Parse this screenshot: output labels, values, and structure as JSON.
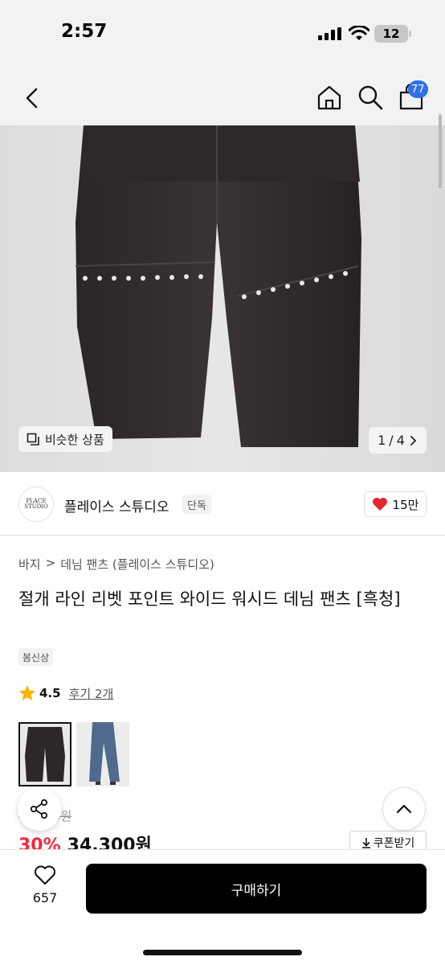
{
  "status_bar": {
    "time": "2:57",
    "battery": "12"
  },
  "header": {
    "cart_count": "77"
  },
  "gallery": {
    "similar_label": "비슷한 상품",
    "page_current": "1",
    "page_sep": "/",
    "page_total": "4"
  },
  "brand": {
    "logo_text": "PLACE STUDIO",
    "name": "플레이스 스튜디오",
    "exclusive_tag": "단독",
    "like_count": "15만"
  },
  "product": {
    "breadcrumb": [
      "바지",
      "데님 팬츠 (플레이스 스튜디오)"
    ],
    "title": "절개 라인 리벳 포인트 와이드 워시드 데님 팬츠 [흑청]",
    "season_tag": "봄신상",
    "rating": "4.5",
    "review_label": "후기 2개",
    "old_price": "49,000원",
    "discount": "30%",
    "price": "34,300원",
    "coupon_label": "쿠폰받기"
  },
  "bottom_bar": {
    "wish_count": "657",
    "buy_label": "구매하기"
  },
  "colors": {
    "accent_blue": "#2f6fec",
    "discount_red": "#ee2b3c",
    "heart_red": "#e5252f",
    "star_yellow": "#f5b400",
    "buy_button": "#000000"
  },
  "icons": [
    "back-icon",
    "home-icon",
    "search-icon",
    "cart-icon",
    "similar-icon",
    "chevron-right-icon",
    "heart-icon",
    "star-icon",
    "share-icon",
    "chevron-up-icon",
    "download-icon",
    "heart-outline-icon"
  ]
}
